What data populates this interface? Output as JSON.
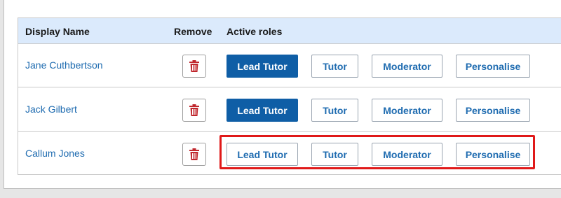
{
  "colors": {
    "header_bg": "#dbeafc",
    "link": "#1e6bb0",
    "active_role_bg": "#0f5ea6",
    "trash_icon": "#c0272d",
    "highlight": "#e01919"
  },
  "table": {
    "headers": {
      "display_name": "Display Name",
      "remove": "Remove",
      "active_roles": "Active roles"
    },
    "role_labels": {
      "lead_tutor": "Lead Tutor",
      "tutor": "Tutor",
      "moderator": "Moderator",
      "personalise": "Personalise"
    },
    "rows": [
      {
        "name": "Jane Cuthbertson",
        "active_roles": [
          "Lead Tutor"
        ]
      },
      {
        "name": "Jack Gilbert",
        "active_roles": [
          "Lead Tutor"
        ]
      },
      {
        "name": "Callum Jones",
        "active_roles": []
      }
    ]
  },
  "remove_icon": "trash-icon"
}
